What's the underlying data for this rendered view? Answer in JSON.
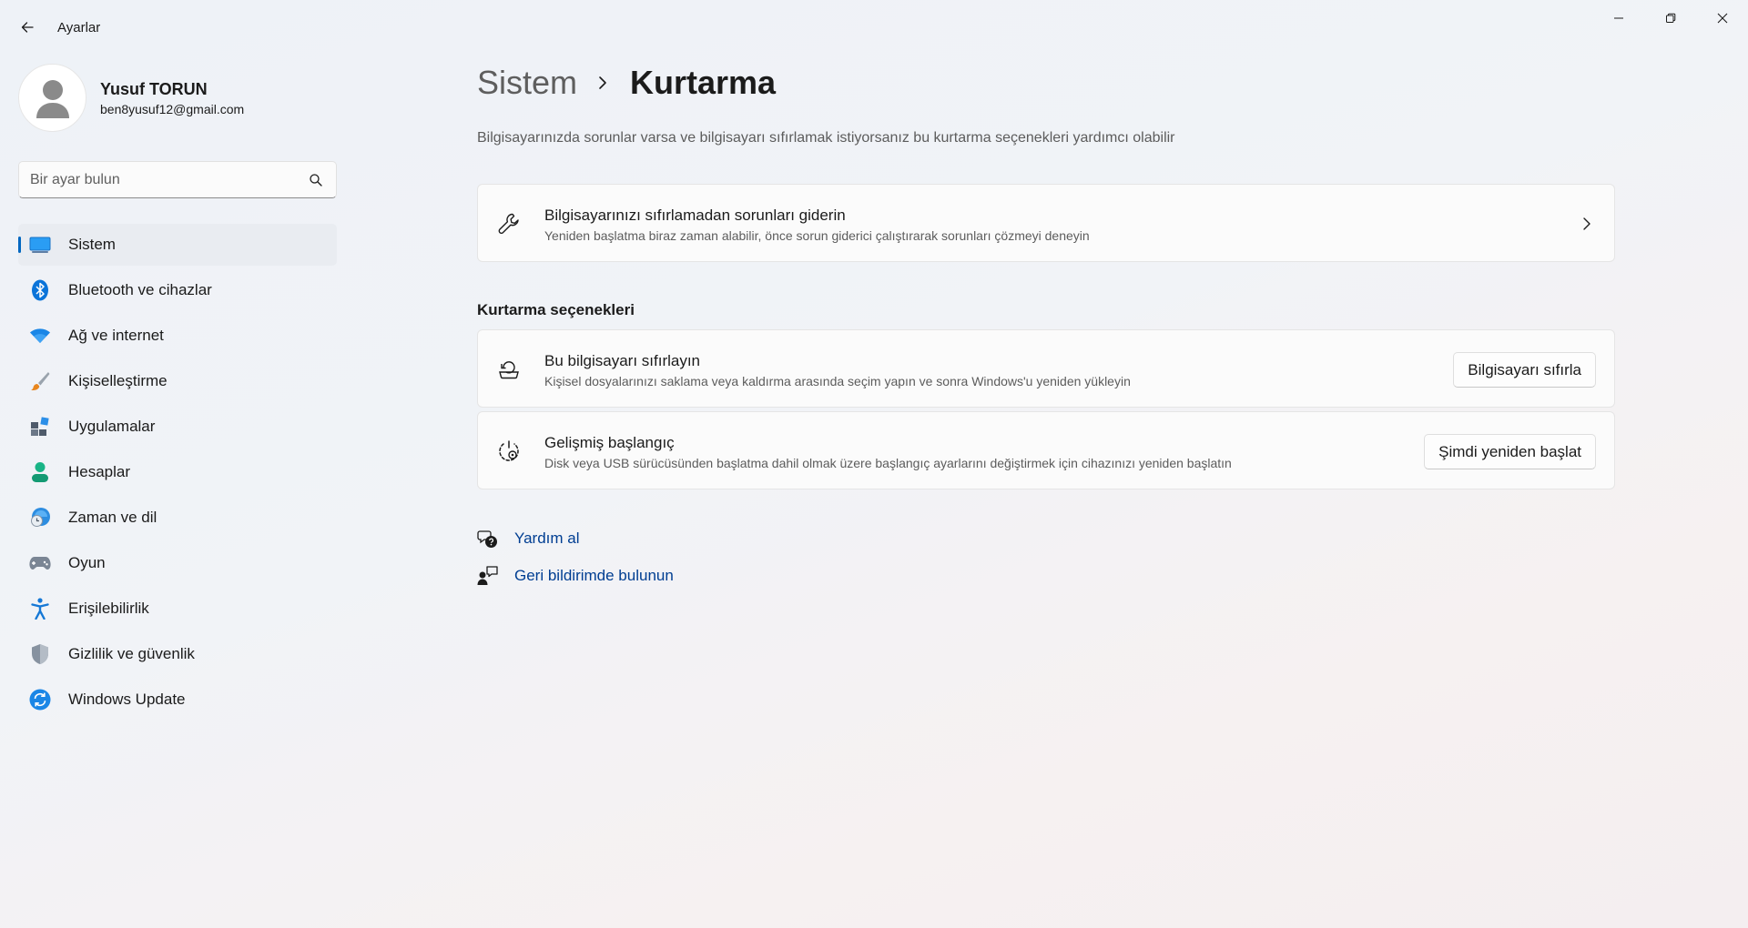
{
  "window": {
    "title": "Ayarlar",
    "controls": {
      "minimize": "minimize-icon",
      "restore": "restore-icon",
      "close": "close-icon"
    }
  },
  "profile": {
    "name": "Yusuf TORUN",
    "email": "ben8yusuf12@gmail.com"
  },
  "search": {
    "placeholder": "Bir ayar bulun",
    "value": ""
  },
  "sidebar": {
    "items": [
      {
        "label": "Sistem",
        "icon": "system-display-icon",
        "active": true
      },
      {
        "label": "Bluetooth ve cihazlar",
        "icon": "bluetooth-icon",
        "active": false
      },
      {
        "label": "Ağ ve internet",
        "icon": "wifi-icon",
        "active": false
      },
      {
        "label": "Kişiselleştirme",
        "icon": "brush-icon",
        "active": false
      },
      {
        "label": "Uygulamalar",
        "icon": "apps-icon",
        "active": false
      },
      {
        "label": "Hesaplar",
        "icon": "account-icon",
        "active": false
      },
      {
        "label": "Zaman ve dil",
        "icon": "time-language-icon",
        "active": false
      },
      {
        "label": "Oyun",
        "icon": "gamepad-icon",
        "active": false
      },
      {
        "label": "Erişilebilirlik",
        "icon": "accessibility-icon",
        "active": false
      },
      {
        "label": "Gizlilik ve güvenlik",
        "icon": "shield-icon",
        "active": false
      },
      {
        "label": "Windows Update",
        "icon": "windows-update-icon",
        "active": false
      }
    ]
  },
  "main": {
    "breadcrumb": {
      "parent": "Sistem",
      "current": "Kurtarma"
    },
    "subtitle": "Bilgisayarınızda sorunlar varsa ve bilgisayarı sıfırlamak istiyorsanız bu kurtarma seçenekleri yardımcı olabilir",
    "troubleshoot_card": {
      "title": "Bilgisayarınızı sıfırlamadan sorunları giderin",
      "description": "Yeniden başlatma biraz zaman alabilir, önce sorun giderici çalıştırarak sorunları çözmeyi deneyin",
      "icon": "wrench-icon"
    },
    "section_title": "Kurtarma seçenekleri",
    "options": [
      {
        "title": "Bu bilgisayarı sıfırlayın",
        "description": "Kişisel dosyalarınızı saklama veya kaldırma arasında seçim yapın ve sonra Windows'u yeniden yükleyin",
        "button": "Bilgisayarı sıfırla",
        "icon": "reset-pc-icon"
      },
      {
        "title": "Gelişmiş başlangıç",
        "description": "Disk veya USB sürücüsünden başlatma dahil olmak üzere başlangıç ayarlarını değiştirmek için cihazınızı yeniden başlatın",
        "button": "Şimdi yeniden başlat",
        "icon": "advanced-startup-icon"
      }
    ],
    "links": [
      {
        "label": "Yardım al",
        "icon": "help-chat-icon"
      },
      {
        "label": "Geri bildirimde bulunun",
        "icon": "feedback-icon"
      }
    ]
  },
  "colors": {
    "accent": "#0067c0",
    "link": "#003e92"
  }
}
